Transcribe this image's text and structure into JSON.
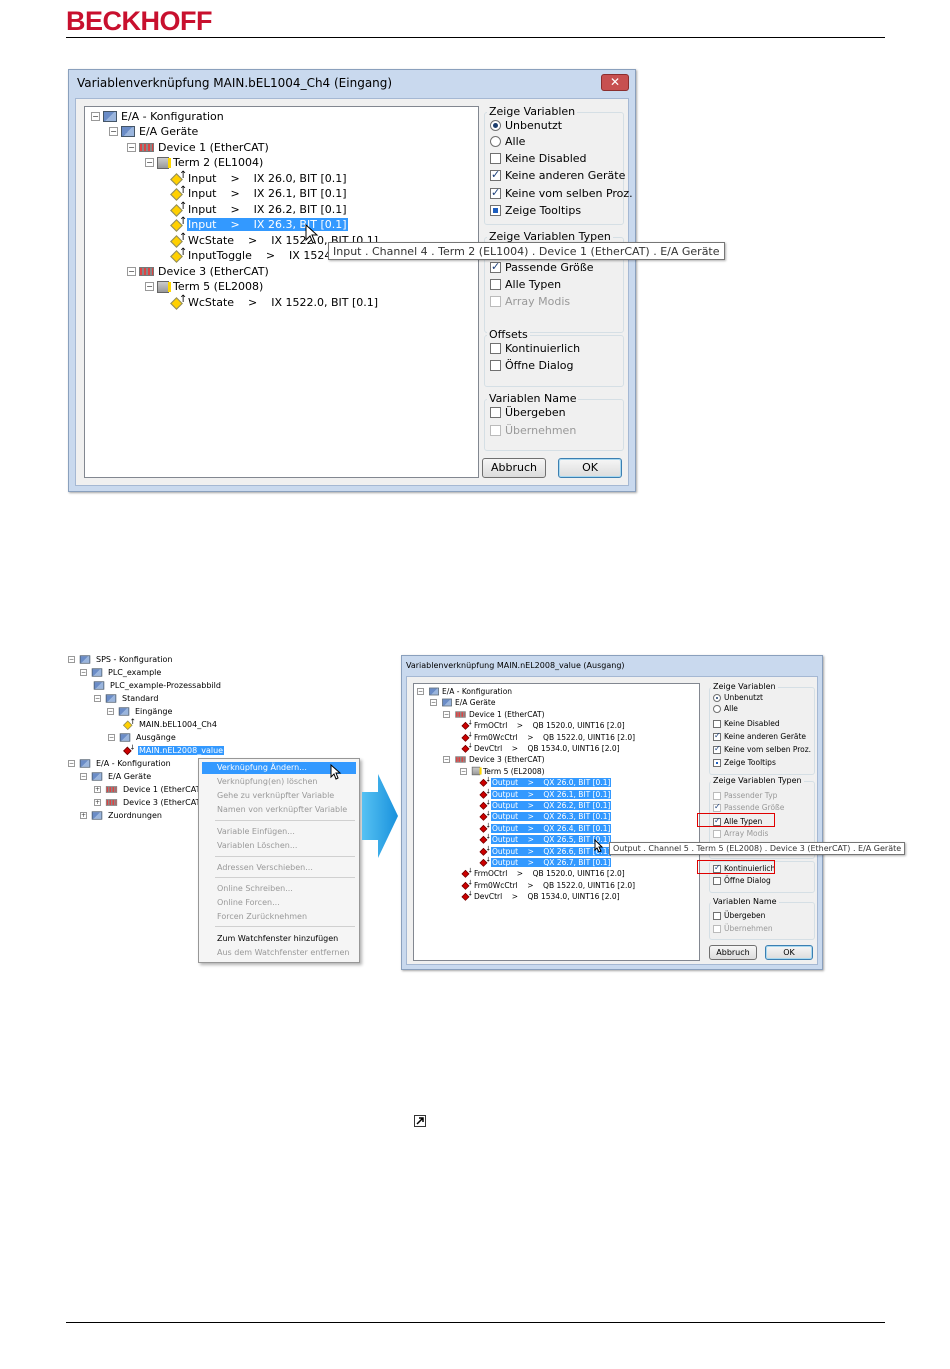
{
  "header": {
    "logo": "BECKHOFF"
  },
  "dialog1": {
    "title": "Variablenverknüpfung MAIN.bEL1004_Ch4 (Eingang)",
    "tree": [
      {
        "label": "E/A - Konfiguration",
        "icon": "io-config-icon",
        "level": 0
      },
      {
        "label": "E/A Geräte",
        "icon": "io-devices-icon",
        "level": 1
      },
      {
        "label": "Device 1 (EtherCAT)",
        "icon": "ethercat-device-icon",
        "level": 2
      },
      {
        "label": "Term 2 (EL1004)",
        "icon": "terminal-icon",
        "level": 3
      },
      {
        "label": "Input    >    IX 26.0, BIT [0.1]",
        "icon": "input-var-icon",
        "level": 4
      },
      {
        "label": "Input    >    IX 26.1, BIT [0.1]",
        "icon": "input-var-icon",
        "level": 4
      },
      {
        "label": "Input    >    IX 26.2, BIT [0.1]",
        "icon": "input-var-icon",
        "level": 4
      },
      {
        "label": "Input    >    IX 26.3, BIT [0.1]",
        "icon": "input-var-icon",
        "level": 4,
        "selected": true
      },
      {
        "label": "WcState    >    IX 1522.0, BIT [0.1]",
        "icon": "input-var-icon",
        "level": 4
      },
      {
        "label": "InputToggle    >    IX 1524.0",
        "icon": "input-var-icon",
        "level": 4
      },
      {
        "label": "Device 3 (EtherCAT)",
        "icon": "ethercat-device-icon",
        "level": 2
      },
      {
        "label": "Term 5 (EL2008)",
        "icon": "terminal-icon",
        "level": 3
      },
      {
        "label": "WcState    >    IX 1522.0, BIT [0.1]",
        "icon": "input-var-icon",
        "level": 4
      }
    ],
    "tooltip": "Input . Channel 4 . Term 2 (EL1004) . Device 1 (EtherCAT) . E/A Geräte",
    "group_show_vars": {
      "title": "Zeige Variablen",
      "options": [
        {
          "label": "Unbenutzt",
          "type": "radio",
          "checked": true
        },
        {
          "label": "Alle",
          "type": "radio",
          "checked": false
        },
        {
          "label": "Keine Disabled",
          "type": "check",
          "checked": false
        },
        {
          "label": "Keine anderen Geräte",
          "type": "check",
          "checked": true
        },
        {
          "label": "Keine vom selben Proz.",
          "type": "check",
          "checked": true
        },
        {
          "label": "Zeige Tooltips",
          "type": "check",
          "checked": "indeterminate"
        }
      ]
    },
    "group_var_types": {
      "title": "Zeige Variablen Typen",
      "options": [
        {
          "label": "Passende Größe",
          "type": "check",
          "checked": true
        },
        {
          "label": "Alle Typen",
          "type": "check",
          "checked": false
        },
        {
          "label": "Array Modis",
          "type": "check",
          "checked": false,
          "disabled": true
        }
      ]
    },
    "group_offsets": {
      "title": "Offsets",
      "options": [
        {
          "label": "Kontinuierlich",
          "type": "check",
          "checked": false
        },
        {
          "label": "Öffne Dialog",
          "type": "check",
          "checked": false
        }
      ]
    },
    "group_var_name": {
      "title": "Variablen Name",
      "options": [
        {
          "label": "Übergeben",
          "type": "check",
          "checked": false
        },
        {
          "label": "Übernehmen",
          "type": "check",
          "checked": false,
          "disabled": true
        }
      ]
    },
    "cancel": "Abbruch",
    "ok": "OK"
  },
  "plc_tree": {
    "items": [
      {
        "label": "SPS - Konfiguration",
        "icon": "plc-config-icon"
      },
      {
        "label": "PLC_example",
        "icon": "plc-project-icon"
      },
      {
        "label": "PLC_example-Prozessabbild",
        "icon": "process-image-icon"
      },
      {
        "label": "Standard",
        "icon": "task-icon"
      },
      {
        "label": "Eingänge",
        "icon": "inputs-icon"
      },
      {
        "label": "MAIN.bEL1004_Ch4",
        "icon": "input-var-icon"
      },
      {
        "label": "Ausgänge",
        "icon": "outputs-icon"
      },
      {
        "label": "MAIN.nEL2008_value",
        "icon": "output-var-icon",
        "selected": true
      },
      {
        "label": "E/A - Konfiguration",
        "icon": "io-config-icon"
      },
      {
        "label": "E/A Geräte",
        "icon": "io-devices-icon"
      },
      {
        "label": "Device 1 (EtherCAT)",
        "icon": "ethercat-device-icon"
      },
      {
        "label": "Device 3 (EtherCAT)",
        "icon": "ethercat-device-icon"
      },
      {
        "label": "Zuordnungen",
        "icon": "mappings-icon"
      }
    ]
  },
  "context_menu": {
    "items": [
      {
        "label": "Verknüpfung Ändern...",
        "highlight": true
      },
      {
        "label": "Verknüpfung(en) löschen",
        "disabled": true
      },
      {
        "label": "Gehe zu verknüpfter Variable",
        "disabled": true
      },
      {
        "label": "Namen von verknüpfter Variable",
        "disabled": true
      },
      {
        "label": "Variable Einfügen...",
        "disabled": true
      },
      {
        "label": "Variablen Löschen...",
        "disabled": true
      },
      {
        "label": "Adressen Verschieben...",
        "disabled": true
      },
      {
        "label": "Online Schreiben...",
        "disabled": true
      },
      {
        "label": "Online Forcen...",
        "disabled": true
      },
      {
        "label": "Forcen Zurücknehmen",
        "disabled": true
      },
      {
        "label": "Zum Watchfenster hinzufügen",
        "disabled": false
      },
      {
        "label": "Aus dem Watchfenster entfernen",
        "disabled": true
      }
    ]
  },
  "dialog2": {
    "title": "Variablenverknüpfung MAIN.nEL2008_value (Ausgang)",
    "tree": [
      {
        "label": "E/A - Konfiguration",
        "level": 0
      },
      {
        "label": "E/A Geräte",
        "level": 1
      },
      {
        "label": "Device 1 (EtherCAT)",
        "level": 2
      },
      {
        "label": "FrmOCtrl    >    QB 1520.0, UINT16 [2.0]",
        "level": 3
      },
      {
        "label": "Frm0WcCtrl    >    QB 1522.0, UINT16 [2.0]",
        "level": 3
      },
      {
        "label": "DevCtrl    >    QB 1534.0, UINT16 [2.0]",
        "level": 3
      },
      {
        "label": "Device 3 (EtherCAT)",
        "level": 2
      },
      {
        "label": "Term 5 (EL2008)",
        "level": 3
      },
      {
        "label": "Output    >    QX 26.0, BIT [0.1]",
        "level": 4,
        "selected": true
      },
      {
        "label": "Output    >    QX 26.1, BIT [0.1]",
        "level": 4,
        "selected": true
      },
      {
        "label": "Output    >    QX 26.2, BIT [0.1]",
        "level": 4,
        "selected": true
      },
      {
        "label": "Output    >    QX 26.3, BIT [0.1]",
        "level": 4,
        "selected": true
      },
      {
        "label": "Output    >    QX 26.4, BIT [0.1]",
        "level": 4,
        "selected": true
      },
      {
        "label": "Output    >    QX 26.5, BIT [0.1]",
        "level": 4,
        "selected": true
      },
      {
        "label": "Output    >    QX 26.6, BIT [0.1]",
        "level": 4,
        "selected": true
      },
      {
        "label": "Output    >    QX 26.7, BIT [0.1]",
        "level": 4,
        "selected": true
      },
      {
        "label": "FrmOCtrl    >    QB 1520.0, UINT16 [2.0]",
        "level": 3
      },
      {
        "label": "Frm0WcCtrl    >    QB 1522.0, UINT16 [2.0]",
        "level": 3
      },
      {
        "label": "DevCtrl    >    QB 1534.0, UINT16 [2.0]",
        "level": 3
      }
    ],
    "tooltip": "Output . Channel 5 . Term 5 (EL2008) . Device 3 (EtherCAT) . E/A Geräte",
    "group_show_vars": {
      "title": "Zeige Variablen",
      "options": [
        {
          "label": "Unbenutzt",
          "type": "radio",
          "checked": true
        },
        {
          "label": "Alle",
          "type": "radio",
          "checked": false
        },
        {
          "label": "Keine Disabled",
          "type": "check",
          "checked": false
        },
        {
          "label": "Keine anderen Geräte",
          "type": "check",
          "checked": true
        },
        {
          "label": "Keine vom selben Proz.",
          "type": "check",
          "checked": true
        },
        {
          "label": "Zeige Tooltips",
          "type": "check",
          "checked": "indeterminate"
        }
      ]
    },
    "group_var_types": {
      "title": "Zeige Variablen Typen",
      "options": [
        {
          "label": "Passender Typ",
          "type": "check",
          "checked": false,
          "disabled": true
        },
        {
          "label": "Passende Größe",
          "type": "check",
          "checked": true,
          "disabled": true
        },
        {
          "label": "Alle Typen",
          "type": "check",
          "checked": true,
          "highlight": true
        },
        {
          "label": "Array Modis",
          "type": "check",
          "checked": false,
          "disabled": true
        }
      ]
    },
    "group_offsets": {
      "options": [
        {
          "label": "Kontinuierlich",
          "type": "check",
          "checked": true,
          "highlight": true
        },
        {
          "label": "Öffne Dialog",
          "type": "check",
          "checked": false
        }
      ]
    },
    "group_var_name": {
      "title": "Variablen Name",
      "options": [
        {
          "label": "Übergeben",
          "type": "check",
          "checked": false
        },
        {
          "label": "Übernehmen",
          "type": "check",
          "checked": false,
          "disabled": true
        }
      ]
    },
    "cancel": "Abbruch",
    "ok": "OK"
  },
  "colors": {
    "brand": "#c8102e",
    "selection": "#3399ff",
    "arrow": "#1e9ee6",
    "highlight_box": "#e00000"
  }
}
